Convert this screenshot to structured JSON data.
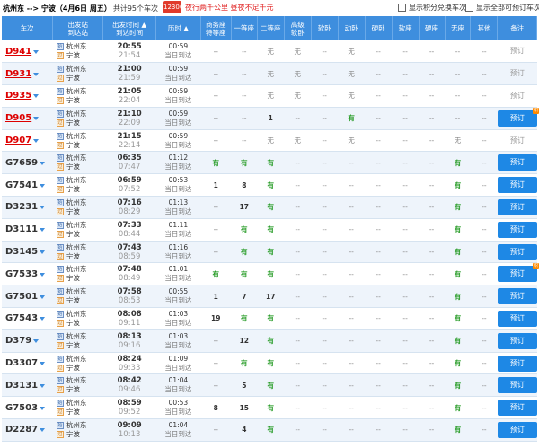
{
  "header": {
    "route": "杭州东 --> 宁波（4月6日 周五）",
    "count": "共计95个车次",
    "ad_text": "夜行两千公里 昼夜不足千元",
    "ad_logo": "12306",
    "check1": "显示积分兑换车次",
    "check2": "显示全部可预订车次"
  },
  "columns": {
    "train": "车次",
    "station": [
      "出发站",
      "到达站"
    ],
    "time": [
      "出发时间",
      "到达时间"
    ],
    "duration": "历时",
    "business": [
      "商务座",
      "特等座"
    ],
    "first": "一等座",
    "second": "二等座",
    "softsleeper_high": [
      "高级",
      "软卧"
    ],
    "softsleeper": "软卧",
    "emu_sleeper": "动卧",
    "hardsleeper": "硬卧",
    "softseat": "软座",
    "hardseat": "硬座",
    "noseat": "无座",
    "other": "其他",
    "remark": "备注"
  },
  "colors": {
    "header_bg": "#3e8ede",
    "book_btn": "#1e88e5",
    "have": "#2a9d2a",
    "train_red": "#d00000"
  },
  "rows": [
    {
      "train": "D941",
      "red": true,
      "from": "杭州东",
      "to": "宁波",
      "dep": "20:55",
      "arr": "21:54",
      "dur": "00:59",
      "day": "当日到达",
      "cells": [
        "--",
        "--",
        "无",
        "无",
        "--",
        "无",
        "--",
        "--",
        "--",
        "--",
        "--"
      ],
      "book": "预订",
      "active": false,
      "badge": false
    },
    {
      "train": "D931",
      "red": true,
      "from": "杭州东",
      "to": "宁波",
      "dep": "21:00",
      "arr": "21:59",
      "dur": "00:59",
      "day": "当日到达",
      "cells": [
        "--",
        "--",
        "无",
        "无",
        "--",
        "无",
        "--",
        "--",
        "--",
        "--",
        "--"
      ],
      "book": "预订",
      "active": false,
      "badge": false
    },
    {
      "train": "D935",
      "red": true,
      "from": "杭州东",
      "to": "宁波",
      "dep": "21:05",
      "arr": "22:04",
      "dur": "00:59",
      "day": "当日到达",
      "cells": [
        "--",
        "--",
        "无",
        "无",
        "--",
        "无",
        "--",
        "--",
        "--",
        "--",
        "--"
      ],
      "book": "预订",
      "active": false,
      "badge": false
    },
    {
      "train": "D905",
      "red": true,
      "from": "杭州东",
      "to": "宁波",
      "dep": "21:10",
      "arr": "22:09",
      "dur": "00:59",
      "day": "当日到达",
      "cells": [
        "--",
        "--",
        "1",
        "--",
        "--",
        "有",
        "--",
        "--",
        "--",
        "--",
        "--"
      ],
      "book": "预订",
      "active": true,
      "badge": true
    },
    {
      "train": "D907",
      "red": true,
      "from": "杭州东",
      "to": "宁波",
      "dep": "21:15",
      "arr": "22:14",
      "dur": "00:59",
      "day": "当日到达",
      "cells": [
        "--",
        "--",
        "无",
        "无",
        "--",
        "无",
        "--",
        "--",
        "--",
        "无",
        "--"
      ],
      "book": "预订",
      "active": false,
      "badge": false
    },
    {
      "train": "G7659",
      "red": false,
      "from": "杭州东",
      "to": "宁波",
      "dep": "06:35",
      "arr": "07:47",
      "dur": "01:12",
      "day": "当日到达",
      "cells": [
        "有",
        "有",
        "有",
        "--",
        "--",
        "--",
        "--",
        "--",
        "--",
        "有",
        "--"
      ],
      "book": "预订",
      "active": true,
      "badge": false
    },
    {
      "train": "G7541",
      "red": false,
      "from": "杭州东",
      "to": "宁波",
      "dep": "06:59",
      "arr": "07:52",
      "dur": "00:53",
      "day": "当日到达",
      "cells": [
        "1",
        "8",
        "有",
        "--",
        "--",
        "--",
        "--",
        "--",
        "--",
        "有",
        "--"
      ],
      "book": "预订",
      "active": true,
      "badge": false
    },
    {
      "train": "D3231",
      "red": false,
      "from": "杭州东",
      "to": "宁波",
      "dep": "07:16",
      "arr": "08:29",
      "dur": "01:13",
      "day": "当日到达",
      "cells": [
        "--",
        "17",
        "有",
        "--",
        "--",
        "--",
        "--",
        "--",
        "--",
        "有",
        "--"
      ],
      "book": "预订",
      "active": true,
      "badge": false
    },
    {
      "train": "D3111",
      "red": false,
      "from": "杭州东",
      "to": "宁波",
      "dep": "07:33",
      "arr": "08:44",
      "dur": "01:11",
      "day": "当日到达",
      "cells": [
        "--",
        "有",
        "有",
        "--",
        "--",
        "--",
        "--",
        "--",
        "--",
        "有",
        "--"
      ],
      "book": "预订",
      "active": true,
      "badge": false
    },
    {
      "train": "D3145",
      "red": false,
      "from": "杭州东",
      "to": "宁波",
      "dep": "07:43",
      "arr": "08:59",
      "dur": "01:16",
      "day": "当日到达",
      "cells": [
        "--",
        "有",
        "有",
        "--",
        "--",
        "--",
        "--",
        "--",
        "--",
        "有",
        "--"
      ],
      "book": "预订",
      "active": true,
      "badge": false
    },
    {
      "train": "G7533",
      "red": false,
      "from": "杭州东",
      "to": "宁波",
      "dep": "07:48",
      "arr": "08:49",
      "dur": "01:01",
      "day": "当日到达",
      "cells": [
        "有",
        "有",
        "有",
        "--",
        "--",
        "--",
        "--",
        "--",
        "--",
        "有",
        "--"
      ],
      "book": "预订",
      "active": true,
      "badge": true
    },
    {
      "train": "G7501",
      "red": false,
      "from": "杭州东",
      "to": "宁波",
      "dep": "07:58",
      "arr": "08:53",
      "dur": "00:55",
      "day": "当日到达",
      "cells": [
        "1",
        "7",
        "17",
        "--",
        "--",
        "--",
        "--",
        "--",
        "--",
        "有",
        "--"
      ],
      "book": "预订",
      "active": true,
      "badge": false
    },
    {
      "train": "G7543",
      "red": false,
      "from": "杭州东",
      "to": "宁波",
      "dep": "08:08",
      "arr": "09:11",
      "dur": "01:03",
      "day": "当日到达",
      "cells": [
        "19",
        "有",
        "有",
        "--",
        "--",
        "--",
        "--",
        "--",
        "--",
        "有",
        "--"
      ],
      "book": "预订",
      "active": true,
      "badge": false
    },
    {
      "train": "D379",
      "red": false,
      "from": "杭州东",
      "to": "宁波",
      "dep": "08:13",
      "arr": "09:16",
      "dur": "01:03",
      "day": "当日到达",
      "cells": [
        "--",
        "12",
        "有",
        "--",
        "--",
        "--",
        "--",
        "--",
        "--",
        "有",
        "--"
      ],
      "book": "预订",
      "active": true,
      "badge": false
    },
    {
      "train": "D3307",
      "red": false,
      "from": "杭州东",
      "to": "宁波",
      "dep": "08:24",
      "arr": "09:33",
      "dur": "01:09",
      "day": "当日到达",
      "cells": [
        "--",
        "有",
        "有",
        "--",
        "--",
        "--",
        "--",
        "--",
        "--",
        "有",
        "--"
      ],
      "book": "预订",
      "active": true,
      "badge": false
    },
    {
      "train": "D3131",
      "red": false,
      "from": "杭州东",
      "to": "宁波",
      "dep": "08:42",
      "arr": "09:46",
      "dur": "01:04",
      "day": "当日到达",
      "cells": [
        "--",
        "5",
        "有",
        "--",
        "--",
        "--",
        "--",
        "--",
        "--",
        "有",
        "--"
      ],
      "book": "预订",
      "active": true,
      "badge": false
    },
    {
      "train": "G7503",
      "red": false,
      "from": "杭州东",
      "to": "宁波",
      "dep": "08:59",
      "arr": "09:52",
      "dur": "00:53",
      "day": "当日到达",
      "cells": [
        "8",
        "15",
        "有",
        "--",
        "--",
        "--",
        "--",
        "--",
        "--",
        "有",
        "--"
      ],
      "book": "预订",
      "active": true,
      "badge": false
    },
    {
      "train": "D2287",
      "red": false,
      "from": "杭州东",
      "to": "宁波",
      "dep": "09:09",
      "arr": "10:13",
      "dur": "01:04",
      "day": "当日到达",
      "cells": [
        "--",
        "4",
        "有",
        "--",
        "--",
        "--",
        "--",
        "--",
        "--",
        "有",
        "--"
      ],
      "book": "预订",
      "active": true,
      "badge": false
    }
  ]
}
